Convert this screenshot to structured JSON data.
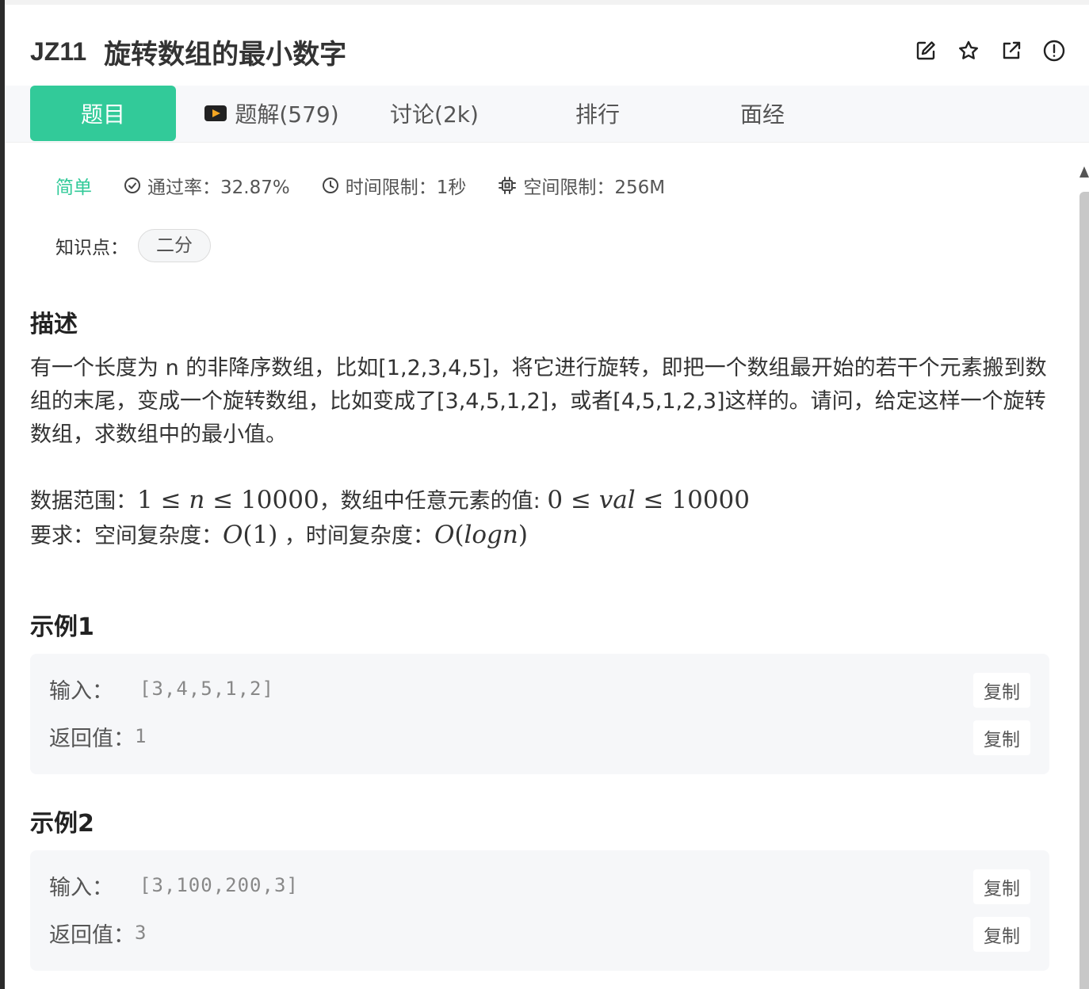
{
  "problem": {
    "id": "JZ11",
    "title": "旋转数组的最小数字"
  },
  "toolbar": {
    "icons": [
      "edit-icon",
      "star-icon",
      "external-link-icon",
      "report-icon"
    ]
  },
  "tabs": [
    {
      "label": "题目",
      "active": true
    },
    {
      "label": "题解(579)",
      "icon": "video-icon"
    },
    {
      "label": "讨论(2k)"
    },
    {
      "label": "排行"
    },
    {
      "label": "面经"
    }
  ],
  "meta": {
    "level": "简单",
    "pass_rate": "通过率：32.87%",
    "time_limit": "时间限制：1秒",
    "space_limit": "空间限制：256M"
  },
  "knowledge": {
    "label": "知识点：",
    "tags": [
      "二分"
    ]
  },
  "description": {
    "heading": "描述",
    "text": "有一个长度为 n 的非降序数组，比如[1,2,3,4,5]，将它进行旋转，即把一个数组最开始的若干个元素搬到数组的末尾，变成一个旋转数组，比如变成了[3,4,5,1,2]，或者[4,5,1,2,3]这样的。请问，给定这样一个旋转数组，求数组中的最小值。",
    "range_prefix": "数据范围：",
    "range_math_1": "1 ≤ ",
    "range_var_1": "n",
    "range_math_2": " ≤ 10000",
    "range_mid": "，数组中任意元素的值: ",
    "range_math_3": "0 ≤ ",
    "range_var_2": "val",
    "range_math_4": " ≤ 10000",
    "req_prefix": "要求：空间复杂度：",
    "req_space_O": "O",
    "req_space_arg": "(1)",
    "req_mid": " ，时间复杂度：",
    "req_time_O": "O",
    "req_time_arg_open": "(",
    "req_time_var": "logn",
    "req_time_arg_close": ")"
  },
  "examples": [
    {
      "heading": "示例1",
      "input_label": "输入：",
      "input_value": "[3,4,5,1,2]",
      "output_label": "返回值：",
      "output_value": "1",
      "copy_label": "复制"
    },
    {
      "heading": "示例2",
      "input_label": "输入：",
      "input_value": "[3,100,200,3]",
      "output_label": "返回值：",
      "output_value": "3",
      "copy_label": "复制"
    }
  ],
  "colors": {
    "accent": "#32ca99",
    "text": "#333333",
    "example_bg": "#f6f7f9"
  }
}
